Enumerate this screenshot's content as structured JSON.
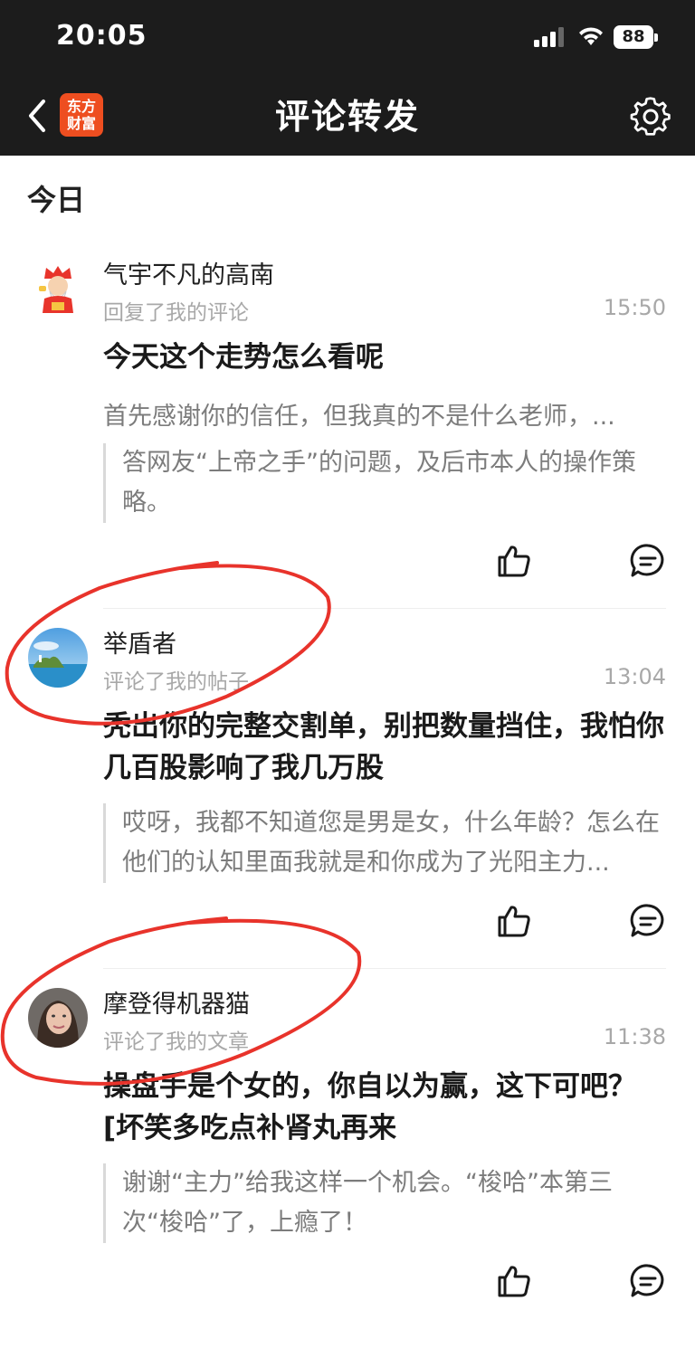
{
  "status_bar": {
    "time": "20:05",
    "battery": "88"
  },
  "nav": {
    "title": "评论转发",
    "logo_line1": "东方",
    "logo_line2": "财富"
  },
  "section_label": "今日",
  "items": [
    {
      "username": "气宇不凡的高南",
      "action": "回复了我的评论",
      "time": "15:50",
      "content": "今天这个走势怎么看呢",
      "excerpt": "首先感谢你的信任，但我真的不是什么老师，...",
      "quote": "答网友“上帝之手”的问题，及后市本人的操作策略。"
    },
    {
      "username": "举盾者",
      "action": "评论了我的帖子",
      "time": "13:04",
      "content": "秃出你的完整交割单，别把数量挡住，我怕你几百股影响了我几万股",
      "quote": "哎呀，我都不知道您是男是女，什么年龄？怎么在他们的认知里面我就是和你成为了光阳主力..."
    },
    {
      "username": "摩登得机器猫",
      "action": "评论了我的文章",
      "time": "11:38",
      "content": "操盘手是个女的，你自以为赢，这下可吧？[坏笑多吃点补肾丸再来",
      "quote": "谢谢“主力”给我这样一个机会。“梭哈”本第三次“梭哈”了，上瘾了！"
    }
  ],
  "colors": {
    "topbar": "#1c1c1c",
    "brand": "#ee4e20",
    "annotation": "#e8332b"
  }
}
